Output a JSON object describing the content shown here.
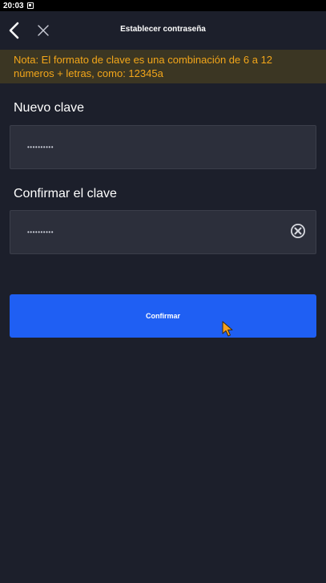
{
  "status_bar": {
    "time": "20:03"
  },
  "header": {
    "title": "Establecer contraseña"
  },
  "note": {
    "text": "Nota: El formato de clave es una combinación de 6 a 12 números + letras, como: 12345a"
  },
  "new_password": {
    "label": "Nuevo clave",
    "value": "••••••••••"
  },
  "confirm_password": {
    "label": "Confirmar el clave",
    "value": "••••••••••"
  },
  "confirm_button": {
    "label": "Confirmar"
  },
  "colors": {
    "background": "#1c1f2b",
    "field_background": "#2c2f3b",
    "note_background": "#3b3623",
    "note_text": "#f3a61a",
    "accent": "#1f5ff3"
  },
  "icons": [
    "back-icon",
    "close-icon",
    "clear-icon",
    "cursor-icon"
  ]
}
